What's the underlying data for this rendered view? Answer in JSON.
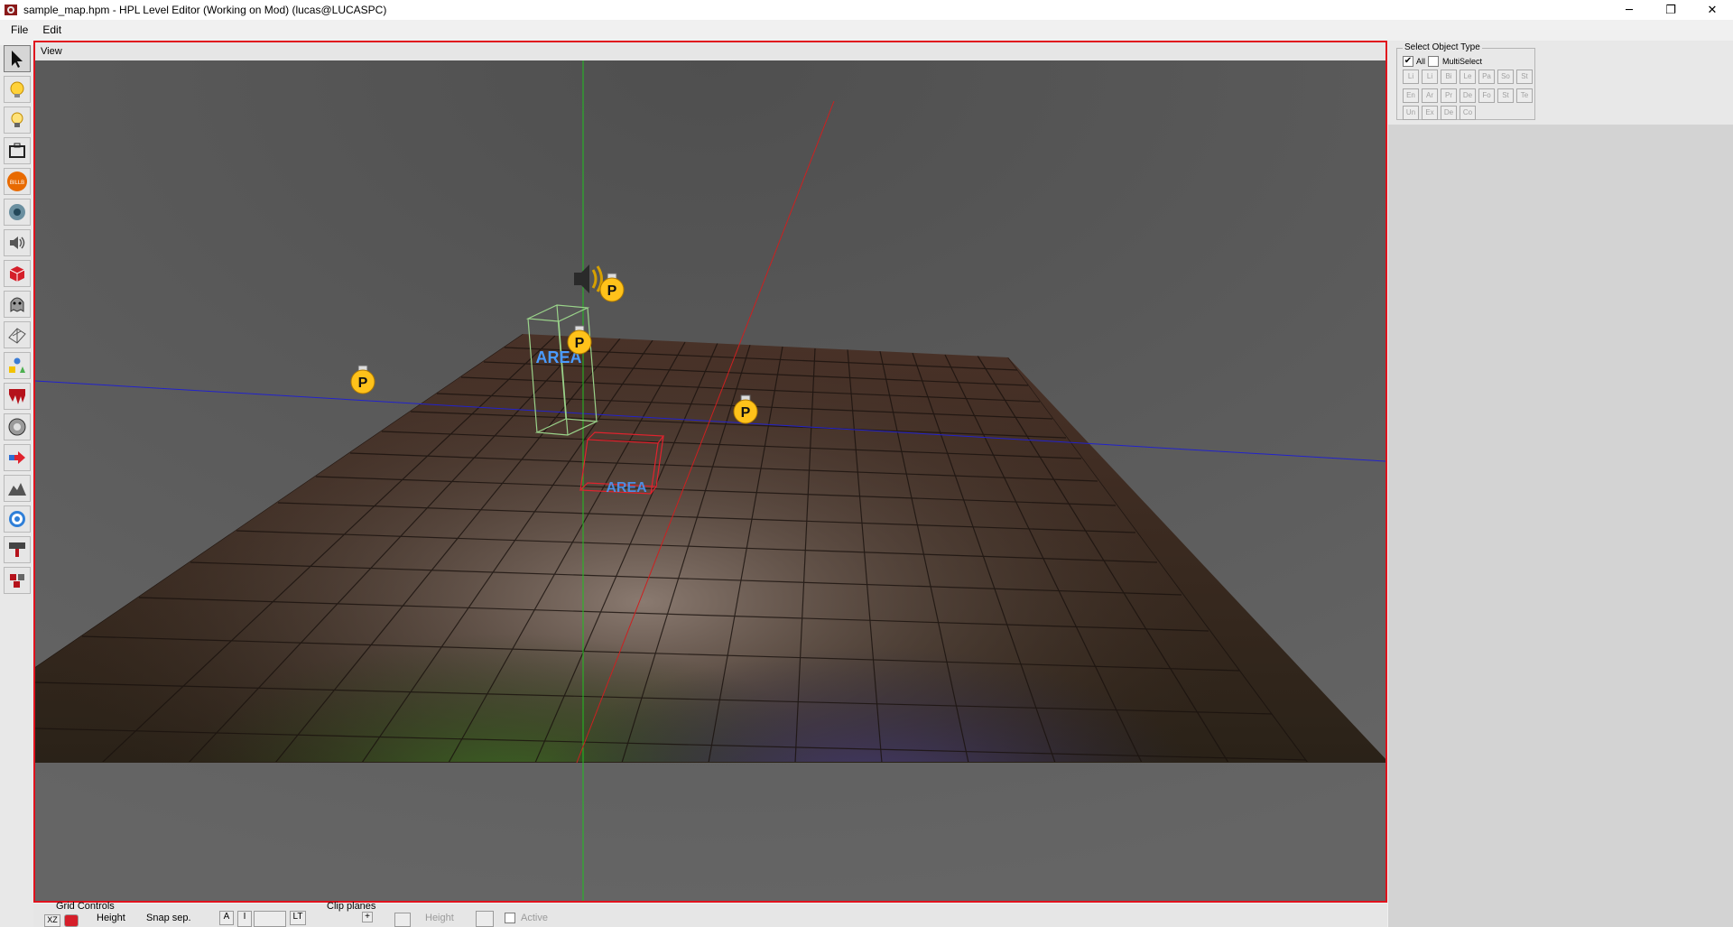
{
  "window": {
    "title": "sample_map.hpm - HPL Level Editor (Working on Mod)  (lucas@LUCASPC)",
    "minimize_glyph": "─",
    "restore_glyph": "❐",
    "close_glyph": "✕"
  },
  "menu": {
    "file": "File",
    "edit": "Edit"
  },
  "toolbar": {
    "tools": [
      "select-arrow-icon",
      "light-icon",
      "lightbulb-icon",
      "box-icon",
      "billboard-icon",
      "particle-icon",
      "sound-icon",
      "static-object-icon",
      "entity-ghost-icon",
      "mesh-grid-icon",
      "primitive-icon",
      "decal-icon",
      "area-icon",
      "arrow-icon",
      "terrain-icon",
      "rotation-icon",
      "combine-icon",
      "compound-icon"
    ],
    "billboard_text": "BILLB"
  },
  "view": {
    "header": "View",
    "area_label_1": "AREA",
    "area_label_2": "AREA",
    "point_light_label": "P",
    "colors": {
      "border": "#e0121d",
      "grid_axis_x": "#2222cc",
      "grid_axis_y": "#20c020",
      "grid_axis_z": "#cc2020",
      "area_box": "#9ad38a",
      "area_text": "#4a9bff"
    }
  },
  "select_object_type": {
    "title": "Select Object Type",
    "all_label": "All",
    "all_checked": true,
    "multiselect_label": "MultiSelect",
    "multiselect_checked": false,
    "types": [
      "Li",
      "Li",
      "Bi",
      "Le",
      "Pa",
      "So",
      "St",
      "En",
      "Ar",
      "Pr",
      "De",
      "Fo",
      "St",
      "Te",
      "Un",
      "Ex",
      "De",
      "Co"
    ]
  },
  "bottom": {
    "grid_controls": "Grid Controls",
    "height": "Height",
    "snap_sep": "Snap sep.",
    "clip_planes": "Clip planes",
    "clip_height": "Height",
    "active": "Active",
    "xz": "XZ",
    "btn_a": "A",
    "btn_i": "I",
    "btn_lt": "LT",
    "btn_plus": "+"
  }
}
